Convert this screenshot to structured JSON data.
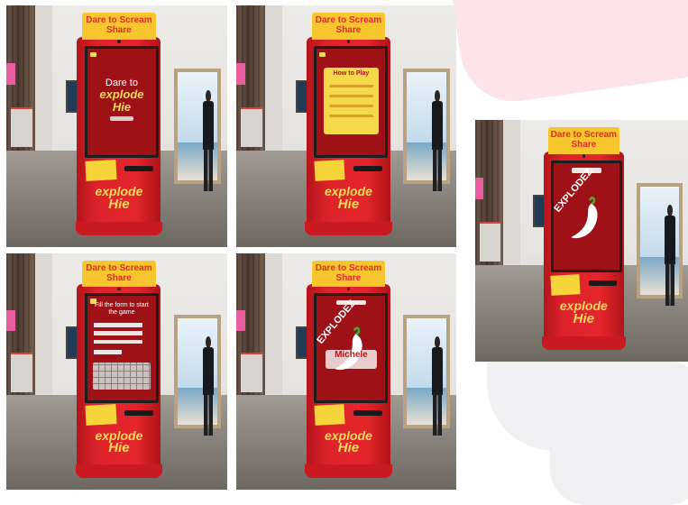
{
  "kiosk": {
    "topper_line1": "Dare to Scream",
    "topper_line2": "Share",
    "brand_line1": "explode",
    "brand_line2": "Hie"
  },
  "screens": {
    "start": {
      "headline": "Dare to",
      "headline_brand": "explode",
      "headline_brand2": "Hie"
    },
    "howto": {
      "title": "How to Play"
    },
    "form": {
      "title_line1": "Fill the form to start",
      "title_line2": "the game"
    },
    "result": {
      "chili_word": "EXPLODEZ"
    },
    "named_result": {
      "chili_word": "EXPLODEZ",
      "player_name": "Michele"
    }
  },
  "colors": {
    "kiosk_red": "#e4262c",
    "topper_yellow": "#f7c62f",
    "brand_yellow": "#f7d95c"
  }
}
